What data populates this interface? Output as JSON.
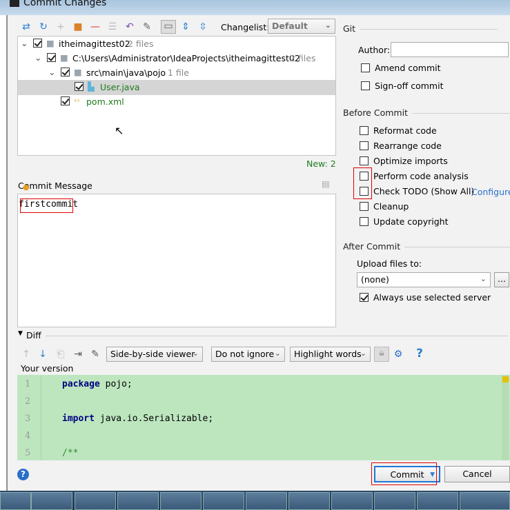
{
  "window": {
    "title": "Commit Changes"
  },
  "toolbar": {
    "changelist_label": "Changelist:",
    "changelist_value": "Default"
  },
  "tree": [
    {
      "name": "itheimagittest02",
      "count": "2 files"
    },
    {
      "name": "C:\\Users\\Administrator\\IdeaProjects\\itheimagittest02",
      "count": "2 files"
    },
    {
      "name": "src\\main\\java\\pojo",
      "count": "1 file"
    },
    {
      "name": "User.java"
    },
    {
      "name": "pom.xml"
    }
  ],
  "status": {
    "new_count": "New: 2"
  },
  "commit_message": {
    "label": "Commit Message",
    "value": "firstcommit"
  },
  "git": {
    "title": "Git",
    "author_label": "Author:",
    "author_value": "",
    "amend": "Amend commit",
    "signoff": "Sign-off commit"
  },
  "before_commit": {
    "title": "Before Commit",
    "items": [
      "Reformat code",
      "Rearrange code",
      "Optimize imports",
      "Perform code analysis",
      "Check TODO (Show All)",
      "Cleanup",
      "Update copyright"
    ],
    "configure": "Configure"
  },
  "after_commit": {
    "title": "After Commit",
    "upload_label": "Upload files to:",
    "upload_value": "(none)",
    "browse": "...",
    "always_use": "Always use selected server"
  },
  "diff": {
    "title": "Diff",
    "viewer": "Side-by-side viewer",
    "ignore": "Do not ignore",
    "highlight": "Highlight words",
    "your_version": "Your version",
    "lines": [
      {
        "n": "1",
        "kw": "package",
        "rest": " pojo;"
      },
      {
        "n": "2",
        "kw": "",
        "rest": ""
      },
      {
        "n": "3",
        "kw": "import",
        "rest": " java.io.Serializable;"
      },
      {
        "n": "4",
        "kw": "",
        "rest": ""
      },
      {
        "n": "5",
        "kw": "",
        "rest": "/**"
      }
    ]
  },
  "buttons": {
    "commit": "Commit",
    "cancel": "Cancel",
    "help": "?"
  },
  "colors": {
    "diff_added": "#bde6bf",
    "file_new": "#1d7a1d",
    "highlight_box": "#e00000",
    "focus": "#1e78d6"
  }
}
